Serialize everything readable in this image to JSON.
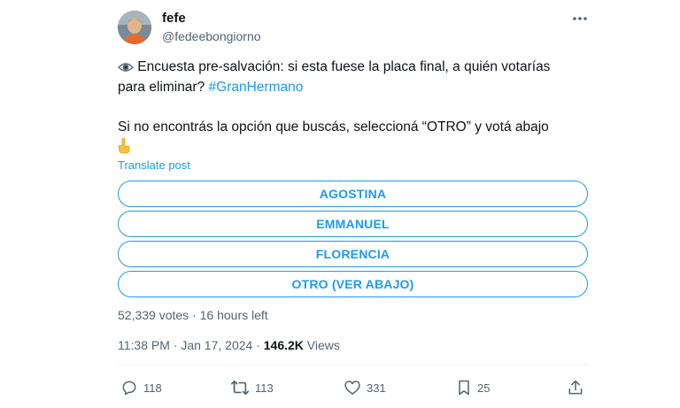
{
  "author": {
    "name": "fefe",
    "handle": "@fedeebongiorno"
  },
  "tweet": {
    "line1_emoji": "👁️",
    "line1_text": " Encuesta pre-salvación: si esta fuese la placa final, a quién votarías",
    "line2_text": "para eliminar? ",
    "hashtag": "#GranHermano",
    "line3_text": "Si no encontrás la opción que buscás, seleccioná “OTRO” y votá abajo",
    "line4_emoji": "👇",
    "translate_label": "Translate post"
  },
  "poll": {
    "options": [
      {
        "label": "AGOSTINA"
      },
      {
        "label": "EMMANUEL"
      },
      {
        "label": "FLORENCIA"
      },
      {
        "label": "OTRO (VER ABAJO)"
      }
    ],
    "votes": "52,339 votes",
    "separator": " · ",
    "time_left": "16 hours left"
  },
  "meta": {
    "time": "11:38 PM",
    "separator": " · ",
    "date": "Jan 17, 2024",
    "separator2": " · ",
    "views_count": "146.2K",
    "views_label": " Views"
  },
  "actions": {
    "replies": "118",
    "reposts": "113",
    "likes": "331",
    "bookmarks": "25"
  },
  "colors": {
    "accent": "#1d9bf0",
    "text": "#0f1419",
    "secondary": "#536471",
    "emoji_eye": "#5b6b7a",
    "emoji_hand": "#f8c33a"
  }
}
